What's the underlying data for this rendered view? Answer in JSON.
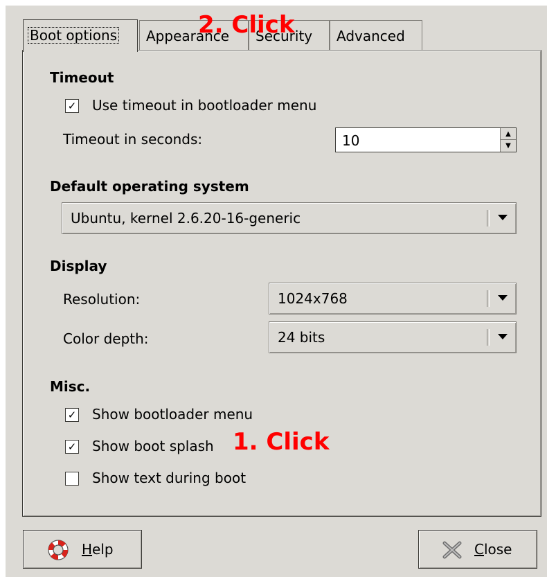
{
  "tabs": [
    {
      "label": "Boot options",
      "active": true
    },
    {
      "label": "Appearance",
      "active": false
    },
    {
      "label": "Security",
      "active": false
    },
    {
      "label": "Advanced",
      "active": false
    }
  ],
  "timeout": {
    "title": "Timeout",
    "use_timeout_label": "Use timeout in bootloader menu",
    "use_timeout_checked": true,
    "seconds_label": "Timeout in seconds:",
    "seconds_value": "10"
  },
  "default_os": {
    "title": "Default operating system",
    "selected": "Ubuntu, kernel 2.6.20-16-generic"
  },
  "display": {
    "title": "Display",
    "resolution_label": "Resolution:",
    "resolution_value": "1024x768",
    "color_depth_label": "Color depth:",
    "color_depth_value": "24 bits"
  },
  "misc": {
    "title": "Misc.",
    "show_menu_label": "Show bootloader menu",
    "show_menu_checked": true,
    "show_splash_label": "Show boot splash",
    "show_splash_checked": true,
    "show_text_label": "Show text during boot",
    "show_text_checked": false
  },
  "buttons": {
    "help_mnemonic": "H",
    "help_rest": "elp",
    "close_mnemonic": "C",
    "close_rest": "lose"
  },
  "annotations": {
    "step1": "1. Click",
    "step2": "2. Click",
    "color": "#ff0000"
  }
}
